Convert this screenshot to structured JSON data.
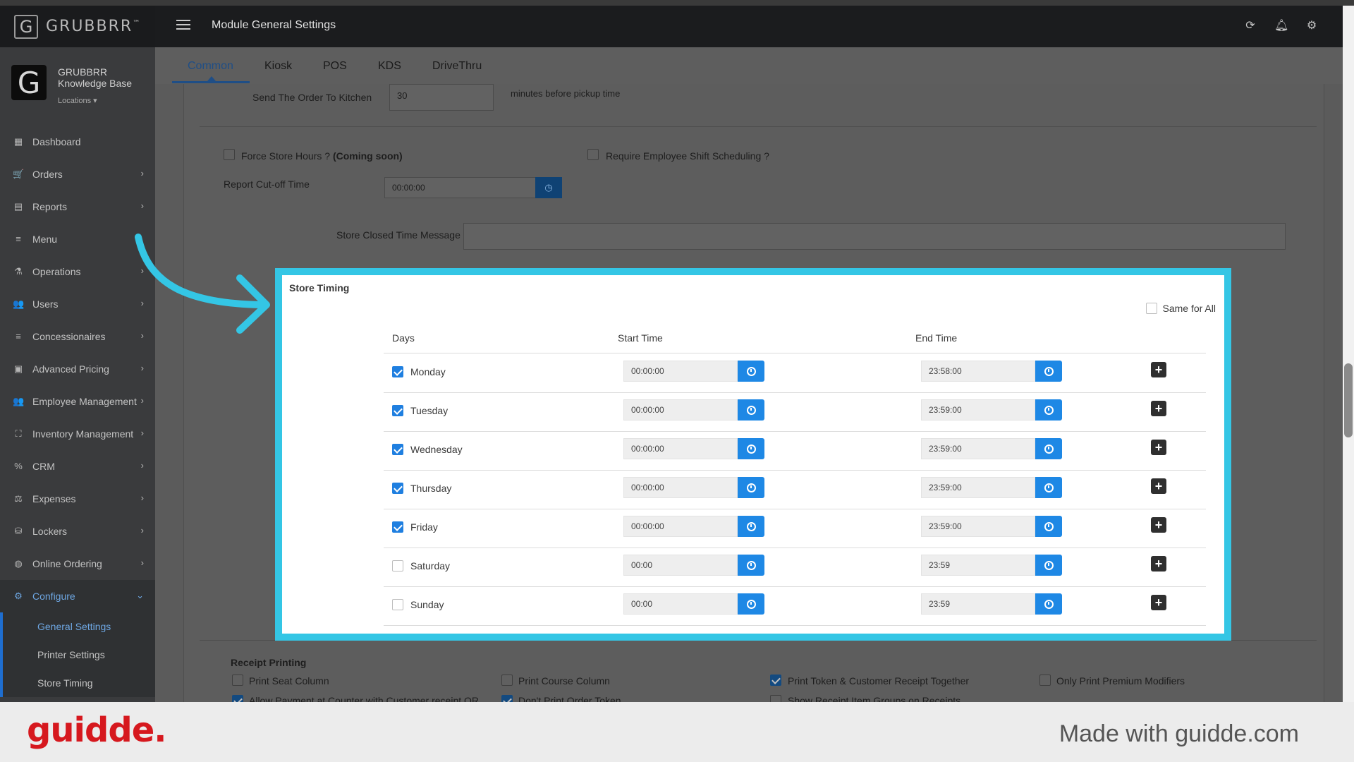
{
  "brand": {
    "name": "GRUBBRR",
    "tm": "™",
    "logo_letter": "G"
  },
  "account": {
    "name": "GRUBBRR Knowledge Base",
    "locations": "Locations ▾"
  },
  "nav": {
    "items": [
      {
        "label": "Dashboard",
        "icon": "dashboard-icon",
        "glyph": "▦",
        "chevron": false
      },
      {
        "label": "Orders",
        "icon": "cart-icon",
        "glyph": "🛒",
        "chevron": true
      },
      {
        "label": "Reports",
        "icon": "report-icon",
        "glyph": "▤",
        "chevron": true
      },
      {
        "label": "Menu",
        "icon": "list-icon",
        "glyph": "≡",
        "chevron": false
      },
      {
        "label": "Operations",
        "icon": "flask-icon",
        "glyph": "⚗",
        "chevron": true
      },
      {
        "label": "Users",
        "icon": "users-icon",
        "glyph": "👥",
        "chevron": true
      },
      {
        "label": "Concessionaires",
        "icon": "list-icon",
        "glyph": "≡",
        "chevron": true
      },
      {
        "label": "Advanced Pricing",
        "icon": "money-icon",
        "glyph": "▣",
        "chevron": true
      },
      {
        "label": "Employee Management",
        "icon": "group-icon",
        "glyph": "👥",
        "chevron": true
      },
      {
        "label": "Inventory Management",
        "icon": "sitemap-icon",
        "glyph": "⛶",
        "chevron": true
      },
      {
        "label": "CRM",
        "icon": "percent-icon",
        "glyph": "%",
        "chevron": true
      },
      {
        "label": "Expenses",
        "icon": "scale-icon",
        "glyph": "⚖",
        "chevron": true
      },
      {
        "label": "Lockers",
        "icon": "lockers-icon",
        "glyph": "⛁",
        "chevron": true
      },
      {
        "label": "Online Ordering",
        "icon": "globe-icon",
        "glyph": "◍",
        "chevron": true
      },
      {
        "label": "Configure",
        "icon": "gear-icon",
        "glyph": "⚙",
        "chevron": true,
        "active": true
      }
    ],
    "sub_items": [
      {
        "label": "General Settings",
        "active": true
      },
      {
        "label": "Printer Settings",
        "active": false
      },
      {
        "label": "Store Timing",
        "active": false
      }
    ]
  },
  "topbar": {
    "title": "Module General Settings"
  },
  "tabs": [
    "Common",
    "Kiosk",
    "POS",
    "KDS",
    "DriveThru"
  ],
  "form": {
    "send_order_label": "Send The Order To Kitchen",
    "send_order_value": "30",
    "send_order_suffix": "minutes before pickup time",
    "force_store_hours": "Force Store Hours ?",
    "coming_soon": "(Coming soon)",
    "require_shift": "Require Employee Shift Scheduling ?",
    "report_cutoff_label": "Report Cut-off Time",
    "report_cutoff_value": "00:00:00",
    "closed_msg_label": "Store Closed Time Message",
    "receipt_title": "Receipt Printing",
    "print_seat": "Print Seat Column",
    "print_course": "Print Course Column",
    "print_token": "Print Token & Customer Receipt Together",
    "only_premium": "Only Print Premium Modifiers",
    "allow_payment": "Allow Payment at Counter with Customer receipt QR",
    "dont_print": "Don't Print Order Token",
    "show_receipt": "Show Receipt Item Groups on Receipts"
  },
  "store_timing": {
    "title": "Store Timing",
    "same_for_all": "Same for All",
    "headers": {
      "days": "Days",
      "start": "Start Time",
      "end": "End Time"
    },
    "rows": [
      {
        "day": "Monday",
        "checked": true,
        "start": "00:00:00",
        "end": "23:58:00"
      },
      {
        "day": "Tuesday",
        "checked": true,
        "start": "00:00:00",
        "end": "23:59:00"
      },
      {
        "day": "Wednesday",
        "checked": true,
        "start": "00:00:00",
        "end": "23:59:00"
      },
      {
        "day": "Thursday",
        "checked": true,
        "start": "00:00:00",
        "end": "23:59:00"
      },
      {
        "day": "Friday",
        "checked": true,
        "start": "00:00:00",
        "end": "23:59:00"
      },
      {
        "day": "Saturday",
        "checked": false,
        "start": "00:00",
        "end": "23:59"
      },
      {
        "day": "Sunday",
        "checked": false,
        "start": "00:00",
        "end": "23:59"
      }
    ]
  },
  "footer": {
    "logo": "guidde.",
    "made_with": "Made with guidde.com"
  },
  "colors": {
    "highlight": "#34c6e5",
    "accent": "#1e88e5",
    "footer_logo": "#d6181e"
  }
}
